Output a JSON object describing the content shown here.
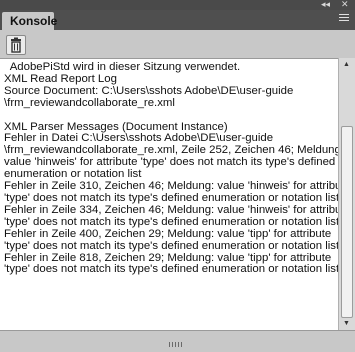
{
  "panel": {
    "tab_label": "Konsole",
    "top_controls": {
      "collapse": "◂◂",
      "close": "✕"
    },
    "toolbar": {
      "clear_icon": "trash-icon"
    },
    "menu_icon": "panel-menu-icon"
  },
  "console": {
    "lines": [
      "  AdobePiStd wird in dieser Sitzung verwendet.",
      "XML Read Report Log",
      "Source Document: C:\\Users\\sshots Adobe\\DE\\user-guide",
      "\\frm_reviewandcollaborate_re.xml",
      "",
      "XML Parser Messages (Document Instance)",
      "Fehler in Datei C:\\Users\\sshots Adobe\\DE\\user-guide",
      "\\frm_reviewandcollaborate_re.xml, Zeile 252, Zeichen 46; Meldung:",
      "value 'hinweis' for attribute 'type' does not match its type's defined",
      "enumeration or notation list",
      "Fehler in Zeile 310, Zeichen 46; Meldung: value 'hinweis' for attribute",
      "'type' does not match its type's defined enumeration or notation list",
      "Fehler in Zeile 334, Zeichen 46; Meldung: value 'hinweis' for attribute",
      "'type' does not match its type's defined enumeration or notation list",
      "Fehler in Zeile 400, Zeichen 29; Meldung: value 'tipp' for attribute",
      "'type' does not match its type's defined enumeration or notation list",
      "Fehler in Zeile 818, Zeichen 29; Meldung: value 'tipp' for attribute",
      "'type' does not match its type's defined enumeration or notation list"
    ]
  }
}
